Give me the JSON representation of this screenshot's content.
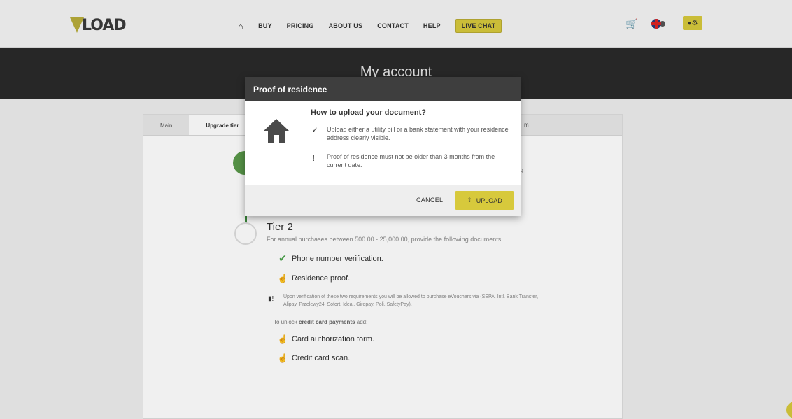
{
  "nav": {
    "logo_text": "LOAD",
    "items": [
      "BUY",
      "PRICING",
      "ABOUT US",
      "CONTACT",
      "HELP"
    ],
    "live_chat": "LIVE CHAT"
  },
  "banner": {
    "title": "My account"
  },
  "card": {
    "tabs": [
      "Main",
      "Upgrade tier"
    ],
    "right_tab_fragment": "m",
    "tier1_fragment": "ing",
    "tier2": {
      "title": "Tier 2",
      "description": "For annual purchases between 500.00 - 25,000.00, provide the following documents:",
      "requirements": [
        "Phone number verification.",
        "Residence proof."
      ],
      "note": "Upon verification of these two requirements you will be allowed to purchase eVouchers via (SEPA, Intl. Bank Transfer, Alipay, Przelewy24, Sofort, Ideal, Giropay, Poli, SafetyPay).",
      "unlock_prefix": "To unlock ",
      "unlock_bold": "credit card payments",
      "unlock_suffix": " add:",
      "extra_requirements": [
        "Card authorization form.",
        "Credit card scan."
      ]
    }
  },
  "modal": {
    "title": "Proof of residence",
    "heading": "How to upload your document?",
    "line1": "Upload either a utility bill or a bank statement with your residence address clearly visible.",
    "line2": "Proof of residence must not be older than 3 months from the current date.",
    "cancel": "CANCEL",
    "upload": "UPLOAD"
  },
  "colors": {
    "accent": "#d7c93c",
    "dark": "#2a2a2a",
    "success": "#4ea44e"
  }
}
